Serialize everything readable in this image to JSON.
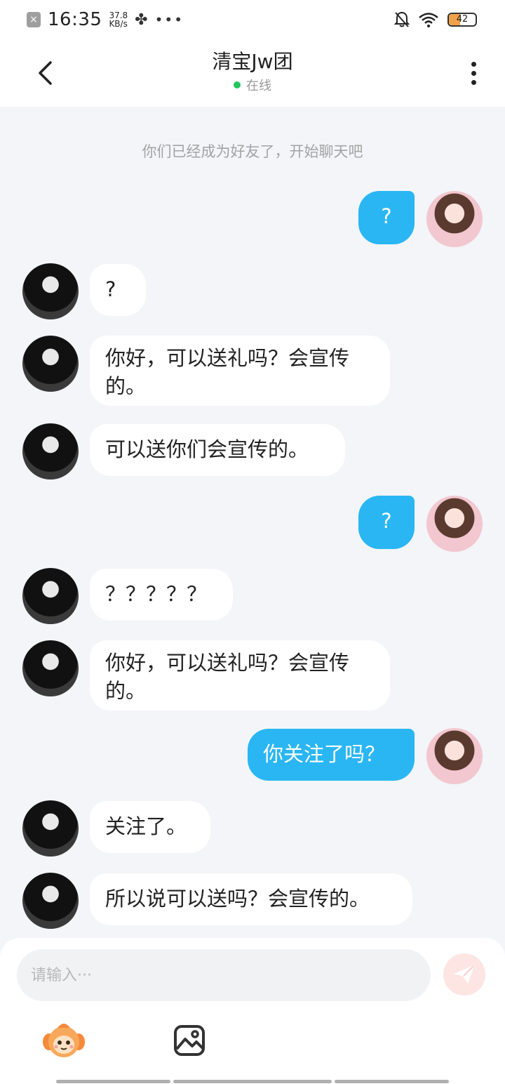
{
  "status_bar": {
    "time": "16:35",
    "net_speed_value": "37.8",
    "net_speed_unit": "KB/s",
    "battery_level": "42",
    "battery_fraction": 0.42,
    "icons": [
      "sim-off-icon",
      "fan-icon",
      "more-dots-icon",
      "bell-off-icon",
      "wifi-icon",
      "battery-icon"
    ]
  },
  "header": {
    "title": "清宝Jw团",
    "status": "在线",
    "status_color": "#22c55e",
    "back_icon": "chevron-left-icon",
    "more_icon": "more-vertical-icon"
  },
  "system_note": "你们已经成为好友了，开始聊天吧",
  "messages": [
    {
      "from": "self",
      "text": "?"
    },
    {
      "from": "friend",
      "text": "?"
    },
    {
      "from": "friend",
      "text": "你好，可以送礼吗？会宣传的。"
    },
    {
      "from": "friend",
      "text": "可以送你们会宣传的。"
    },
    {
      "from": "self",
      "text": "?"
    },
    {
      "from": "friend",
      "text": "？？？？？"
    },
    {
      "from": "friend",
      "text": "你好，可以送礼吗？会宣传的。"
    },
    {
      "from": "self",
      "text": "你关注了吗？"
    },
    {
      "from": "friend",
      "text": "关注了。"
    },
    {
      "from": "friend",
      "text": "所以说可以送吗？会宣传的。"
    }
  ],
  "input": {
    "placeholder": "请输入···",
    "value": ""
  },
  "toolbar": {
    "send_icon": "send-icon",
    "emoji_icon": "mascot-emoji-icon",
    "image_icon": "image-icon"
  },
  "colors": {
    "outgoing_bubble": "#2ab6f3",
    "incoming_bubble": "#ffffff",
    "background": "#f3f5f8",
    "send_button": "#fde5e3"
  }
}
